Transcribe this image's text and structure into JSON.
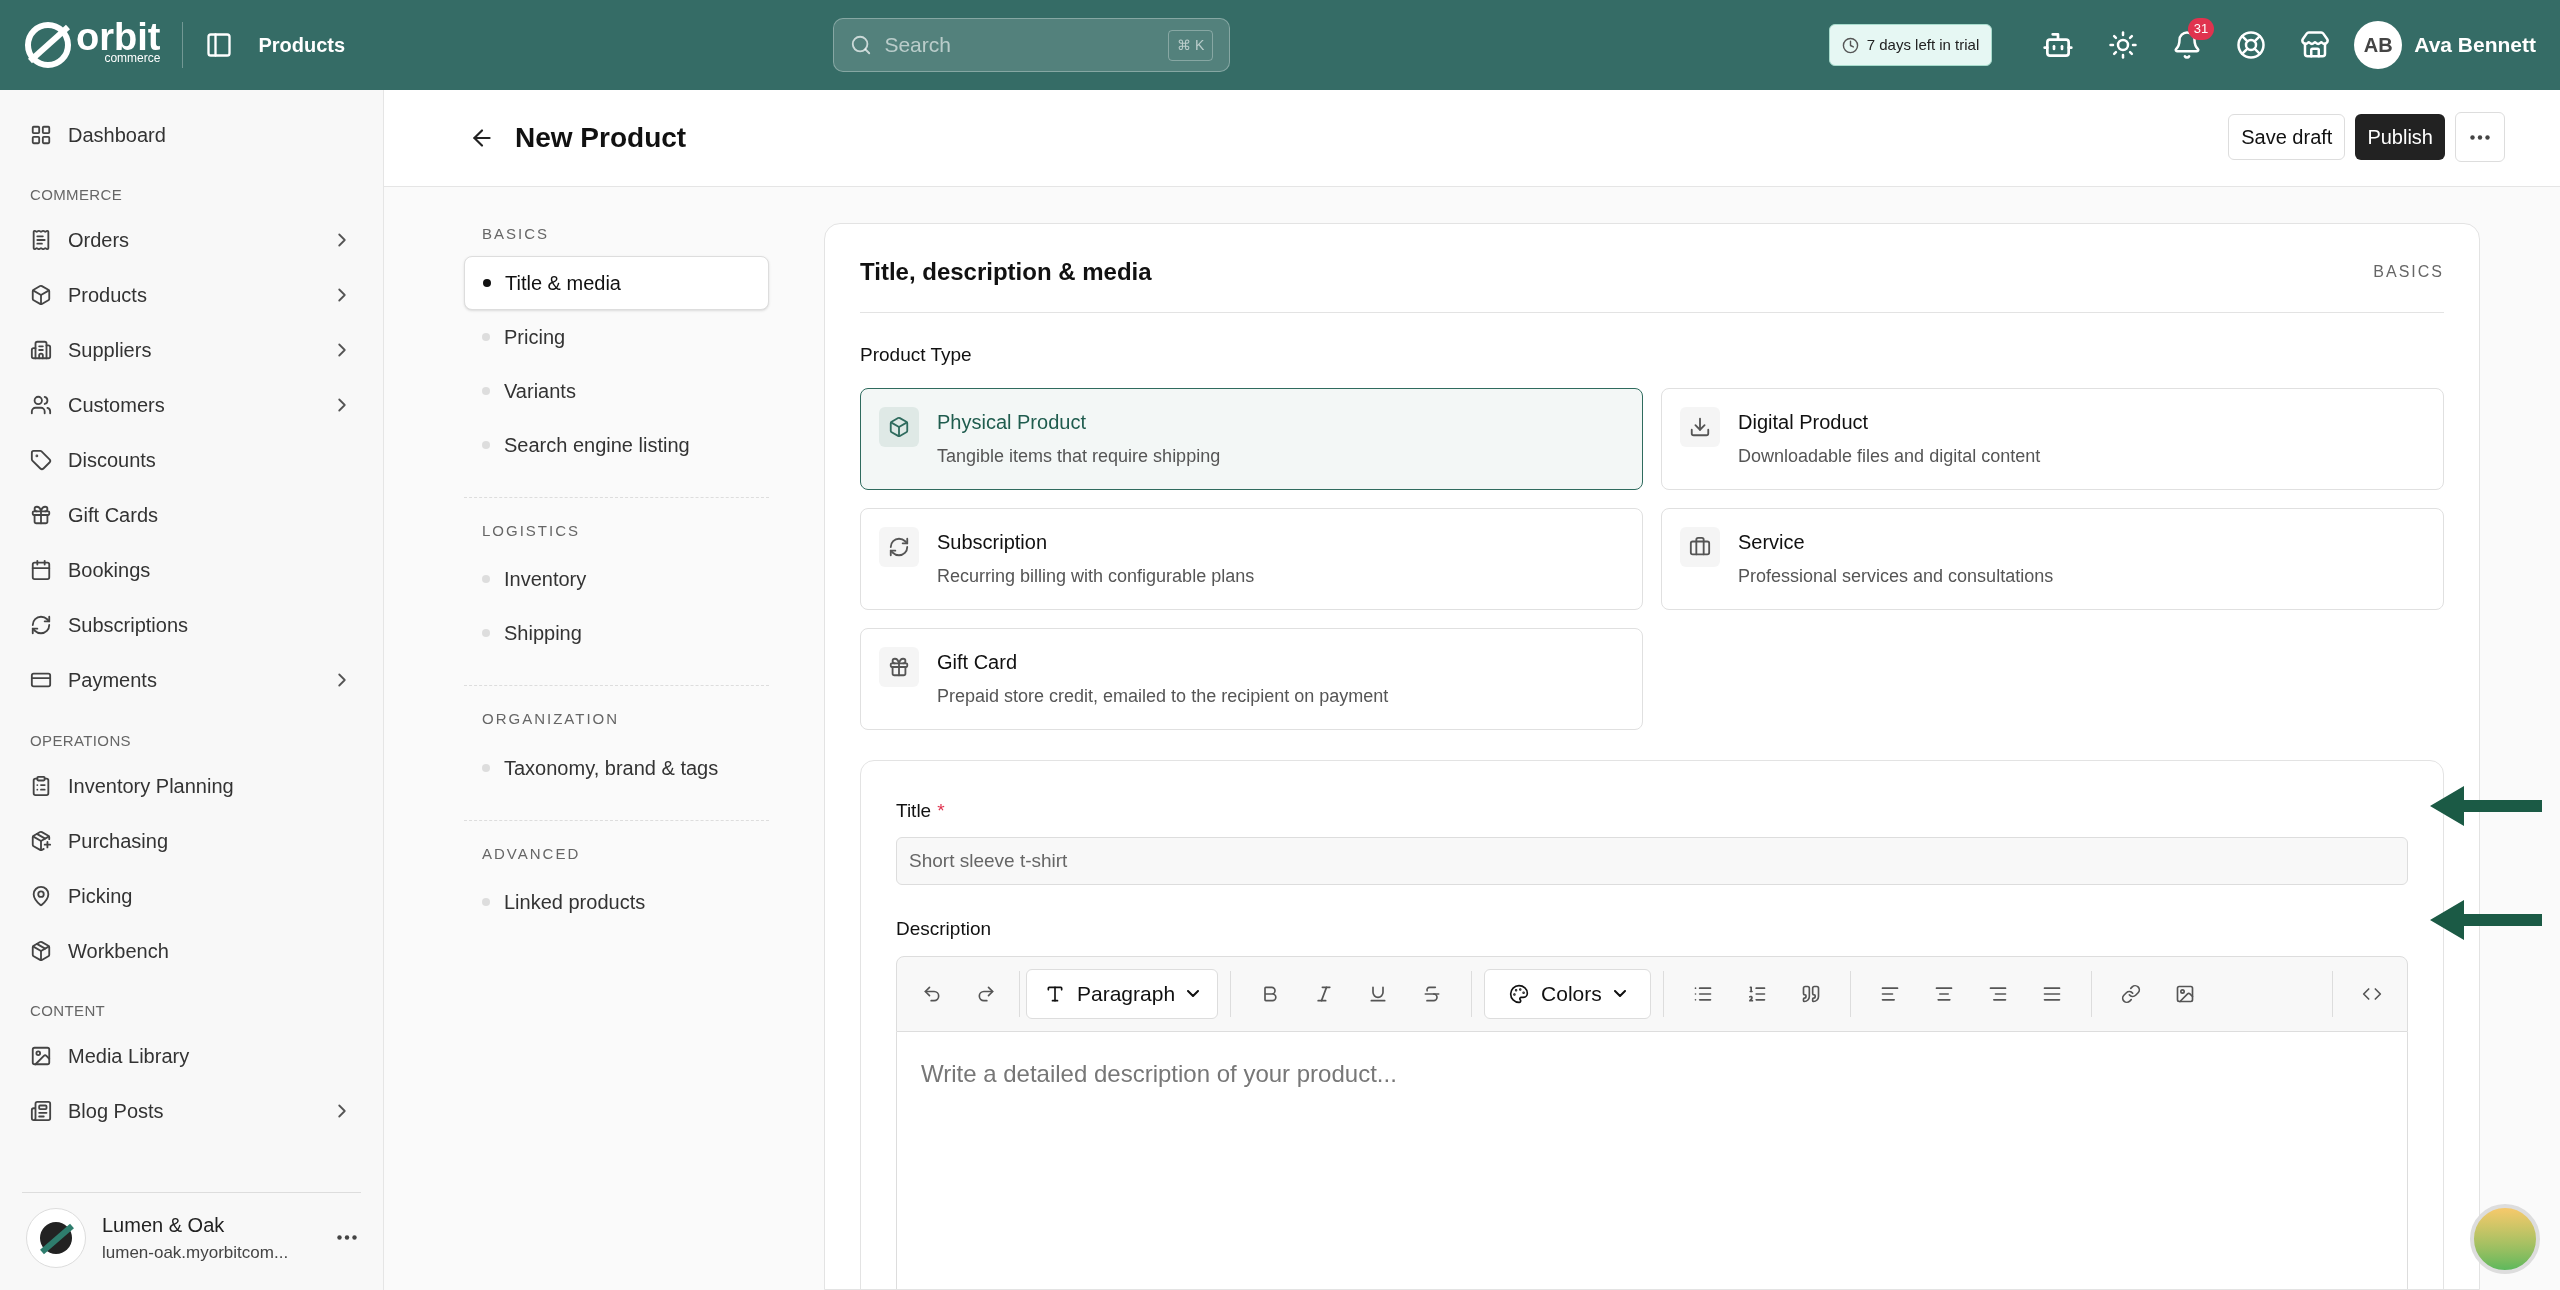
{
  "topbar": {
    "logo": {
      "wordmark": "orbit",
      "sub": "commerce"
    },
    "section": "Products",
    "search": {
      "placeholder": "Search",
      "shortcut": "⌘ K"
    },
    "trial": "7 days left in trial",
    "notifications": "31",
    "user": {
      "initials": "AB",
      "name": "Ava Bennett"
    }
  },
  "sidebar": {
    "top": [
      {
        "label": "Dashboard",
        "expandable": false
      }
    ],
    "sections": [
      {
        "heading": "COMMERCE",
        "items": [
          {
            "label": "Orders",
            "expandable": true
          },
          {
            "label": "Products",
            "expandable": true
          },
          {
            "label": "Suppliers",
            "expandable": true
          },
          {
            "label": "Customers",
            "expandable": true
          },
          {
            "label": "Discounts",
            "expandable": false
          },
          {
            "label": "Gift Cards",
            "expandable": false
          },
          {
            "label": "Bookings",
            "expandable": false
          },
          {
            "label": "Subscriptions",
            "expandable": false
          },
          {
            "label": "Payments",
            "expandable": true
          }
        ]
      },
      {
        "heading": "OPERATIONS",
        "items": [
          {
            "label": "Inventory Planning",
            "expandable": false
          },
          {
            "label": "Purchasing",
            "expandable": false
          },
          {
            "label": "Picking",
            "expandable": false
          },
          {
            "label": "Workbench",
            "expandable": false
          }
        ]
      },
      {
        "heading": "CONTENT",
        "items": [
          {
            "label": "Media Library",
            "expandable": false
          },
          {
            "label": "Blog Posts",
            "expandable": true
          }
        ]
      }
    ],
    "store": {
      "name": "Lumen & Oak",
      "domain": "lumen-oak.myorbitcom..."
    }
  },
  "page": {
    "title": "New Product",
    "save": "Save draft",
    "publish": "Publish"
  },
  "section_nav": [
    {
      "heading": "BASICS",
      "items": [
        {
          "label": "Title & media",
          "selected": true
        },
        {
          "label": "Pricing",
          "selected": false
        },
        {
          "label": "Variants",
          "selected": false
        },
        {
          "label": "Search engine listing",
          "selected": false
        }
      ]
    },
    {
      "heading": "LOGISTICS",
      "items": [
        {
          "label": "Inventory",
          "selected": false
        },
        {
          "label": "Shipping",
          "selected": false
        }
      ]
    },
    {
      "heading": "ORGANIZATION",
      "items": [
        {
          "label": "Taxonomy, brand & tags",
          "selected": false
        }
      ]
    },
    {
      "heading": "ADVANCED",
      "items": [
        {
          "label": "Linked products",
          "selected": false
        }
      ]
    }
  ],
  "card": {
    "title": "Title, description & media",
    "tag": "BASICS",
    "product_type": {
      "label": "Product Type",
      "options": [
        {
          "title": "Physical Product",
          "description": "Tangible items that require shipping",
          "selected": true
        },
        {
          "title": "Digital Product",
          "description": "Downloadable files and digital content",
          "selected": false
        },
        {
          "title": "Subscription",
          "description": "Recurring billing with configurable plans",
          "selected": false
        },
        {
          "title": "Service",
          "description": "Professional services and consultations",
          "selected": false
        },
        {
          "title": "Gift Card",
          "description": "Prepaid store credit, emailed to the recipient on payment",
          "selected": false
        }
      ]
    },
    "title_field": {
      "label": "Title",
      "required_mark": "*",
      "placeholder": "Short sleeve t-shirt"
    },
    "description": {
      "label": "Description",
      "block_style": "Paragraph",
      "colors": "Colors",
      "placeholder": "Write a detailed description of your product..."
    }
  }
}
